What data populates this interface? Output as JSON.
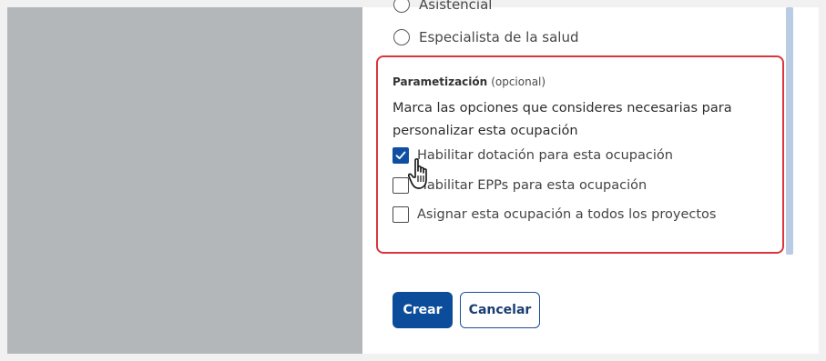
{
  "radios": [
    {
      "label": "Asistencial"
    },
    {
      "label": "Especialista de la salud"
    }
  ],
  "parametrizacion": {
    "title": "Parametización",
    "optional": "(opcional)",
    "description": "Marca las opciones que consideres necesarias para personalizar esta ocupación",
    "options": [
      {
        "label": "Habilitar dotación para esta ocupación",
        "checked": true
      },
      {
        "label": "Habilitar EPPs para esta ocupación",
        "checked": false
      },
      {
        "label": "Asignar esta ocupación a todos los proyectos",
        "checked": false
      }
    ]
  },
  "buttons": {
    "create": "Crear",
    "cancel": "Cancelar"
  },
  "colors": {
    "accent": "#0b4c9b",
    "highlight_border": "#d9363e",
    "side_panel": "#b4b7ba"
  },
  "icons": {
    "check": "check-icon",
    "cursor": "hand-pointer-icon"
  }
}
